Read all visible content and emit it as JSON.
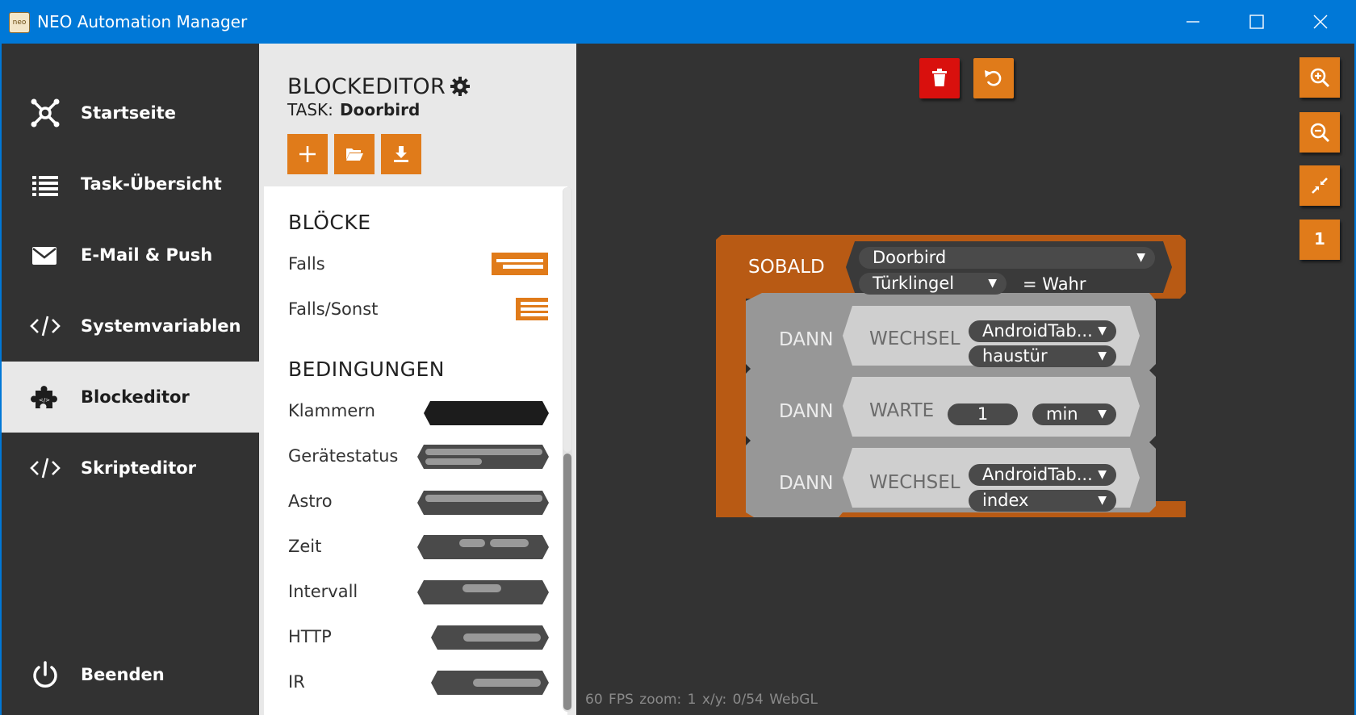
{
  "window": {
    "title": "NEO Automation Manager",
    "icon_text": "neo"
  },
  "sidebar": {
    "items": [
      {
        "label": "Startseite",
        "icon": "network-icon"
      },
      {
        "label": "Task-Übersicht",
        "icon": "list-icon"
      },
      {
        "label": "E-Mail & Push",
        "icon": "envelope-icon"
      },
      {
        "label": "Systemvariablen",
        "icon": "code-icon"
      },
      {
        "label": "Blockeditor",
        "icon": "puzzle-icon",
        "active": true
      },
      {
        "label": "Skripteditor",
        "icon": "code-icon"
      }
    ],
    "quit_label": "Beenden"
  },
  "panel": {
    "title": "BLOCKEDITOR",
    "task_label": "TASK:",
    "task_name": "Doorbird",
    "sections": {
      "blocks_heading": "BLÖCKE",
      "blocks": [
        "Falls",
        "Falls/Sonst"
      ],
      "conditions_heading": "BEDINGUNGEN",
      "conditions": [
        "Klammern",
        "Gerätestatus",
        "Astro",
        "Zeit",
        "Intervall",
        "HTTP",
        "IR"
      ]
    }
  },
  "canvas": {
    "zoom_level_badge": "1",
    "status": {
      "fps": "60 FPS",
      "zoom": "zoom: 1",
      "xy": "x/y: 0/54",
      "renderer": "WebGL"
    },
    "block": {
      "trigger_label": "SOBALD",
      "trigger_device": "Doorbird",
      "trigger_state": "Türklingel",
      "trigger_condition": "= Wahr",
      "actions": [
        {
          "label": "DANN",
          "action": "WECHSEL",
          "device": "AndroidTab...",
          "value": "haustür"
        },
        {
          "label": "DANN",
          "action": "WARTE",
          "amount": "1",
          "unit": "min"
        },
        {
          "label": "DANN",
          "action": "WECHSEL",
          "device": "AndroidTab...",
          "value": "index"
        }
      ]
    }
  },
  "colors": {
    "accent": "#e07b1a",
    "block_orange": "#b85a14",
    "titlebar": "#0078d7",
    "sidebar": "#323232",
    "canvas": "#333333",
    "delete": "#d9100d"
  }
}
